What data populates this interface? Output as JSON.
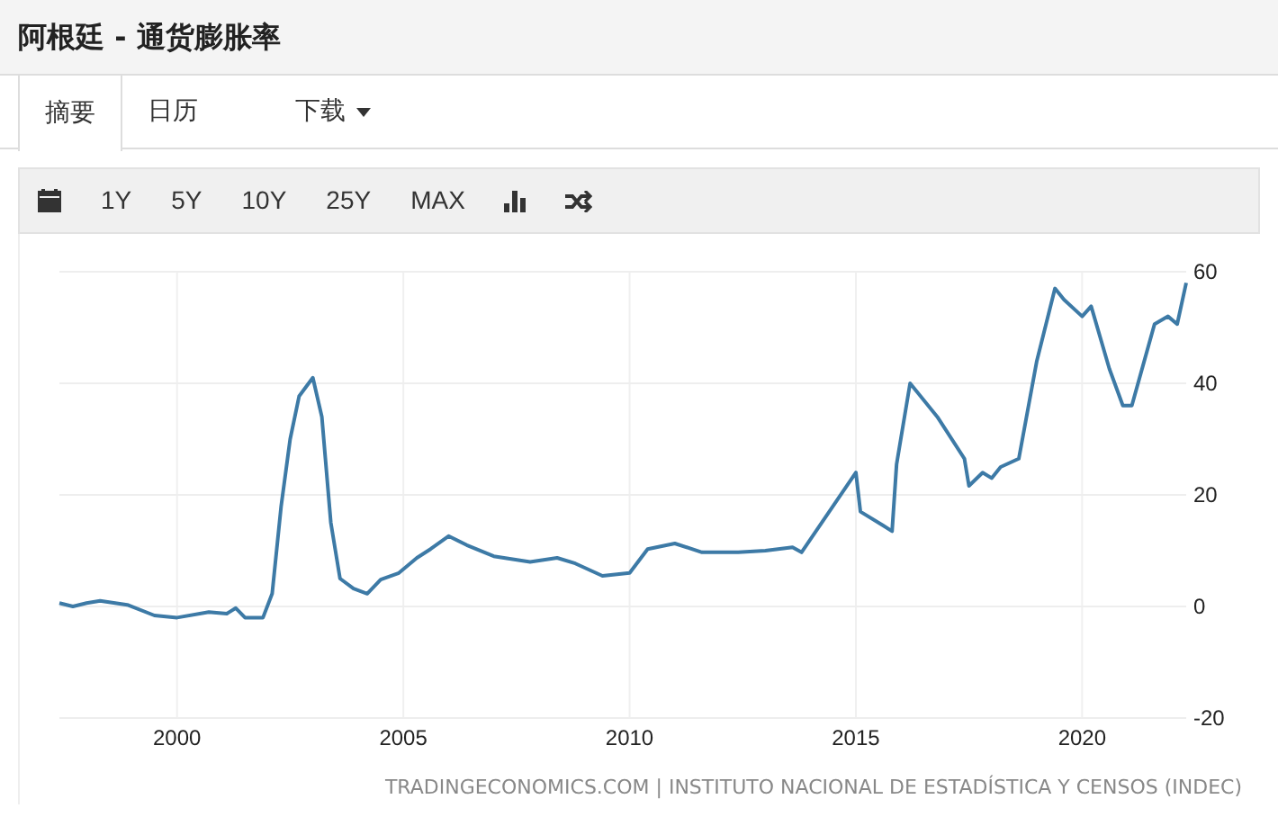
{
  "title": "阿根廷 - 通货膨胀率",
  "tabs": [
    {
      "label": "摘要",
      "selected": true,
      "kind": "tab"
    },
    {
      "label": "日历",
      "selected": false,
      "kind": "tab"
    },
    {
      "label": "下载",
      "selected": false,
      "kind": "dropdown"
    }
  ],
  "toolbar": [
    {
      "kind": "calendar"
    },
    {
      "kind": "range",
      "label": "1Y"
    },
    {
      "kind": "range",
      "label": "5Y"
    },
    {
      "kind": "range",
      "label": "10Y"
    },
    {
      "kind": "range",
      "label": "25Y"
    },
    {
      "kind": "range",
      "label": "MAX"
    },
    {
      "kind": "bars"
    },
    {
      "kind": "shuffle"
    }
  ],
  "chart_data": {
    "type": "line",
    "grid": true,
    "xlim": [
      1997.4,
      2022.3
    ],
    "ylim": [
      -20,
      60
    ],
    "xticks": [
      2000,
      2005,
      2010,
      2015,
      2020
    ],
    "yticks": [
      -20,
      0,
      20,
      40,
      60
    ],
    "x": [
      1997.4,
      1997.7,
      1998,
      1998.3,
      1998.9,
      1999.5,
      2000,
      2000.7,
      2001.1,
      2001.3,
      2001.5,
      2001.9,
      2002.1,
      2002.3,
      2002.5,
      2002.7,
      2003,
      2003.2,
      2003.4,
      2003.6,
      2003.9,
      2004.2,
      2004.5,
      2004.9,
      2005.3,
      2005.6,
      2006,
      2006.4,
      2007,
      2007.8,
      2008.4,
      2008.8,
      2009.4,
      2010,
      2010.4,
      2011,
      2011.6,
      2012.4,
      2013,
      2013.6,
      2013.8,
      2015,
      2015.1,
      2015.6,
      2015.8,
      2015.9,
      2016.2,
      2016.8,
      2017.4,
      2017.5,
      2017.8,
      2018,
      2018.2,
      2018.6,
      2019,
      2019.4,
      2019.6,
      2020,
      2020.2,
      2020.6,
      2020.9,
      2021.1,
      2021.6,
      2021.9,
      2022.1,
      2022.3
    ],
    "series": [
      {
        "color": "#3d7aa6",
        "values": [
          0.6,
          0,
          0.6,
          1,
          0.3,
          -1.6,
          -2,
          -1,
          -1.3,
          -0.3,
          -2,
          -2,
          2.3,
          18,
          30,
          37.7,
          41,
          34,
          15,
          5,
          3.2,
          2.3,
          4.8,
          6,
          8.7,
          10.3,
          12.6,
          11,
          9,
          8,
          8.7,
          7.7,
          5.5,
          6,
          10.3,
          11.3,
          9.7,
          9.7,
          10,
          10.6,
          9.7,
          24,
          17,
          14.5,
          13.5,
          25.5,
          40,
          34,
          26.5,
          21.6,
          24,
          23,
          25,
          26.5,
          44,
          57,
          55,
          52,
          53.8,
          42.6,
          36,
          36,
          50.6,
          52,
          50.6,
          58
        ]
      }
    ]
  },
  "source": "TRADINGECONOMICS.COM | INSTITUTO NACIONAL DE ESTADÍSTICA Y CENSOS (INDEC)"
}
